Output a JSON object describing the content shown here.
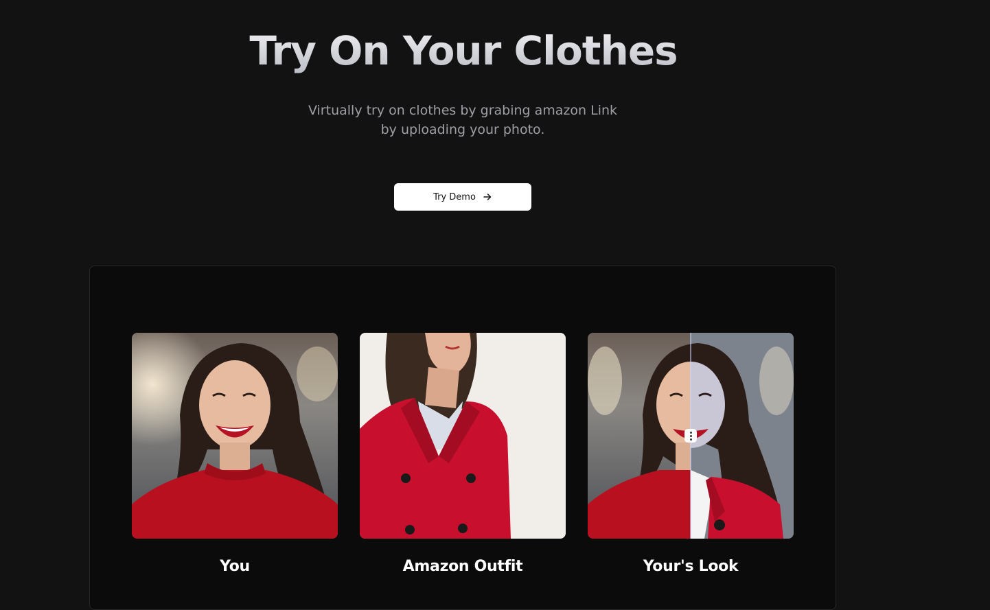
{
  "hero": {
    "title": "Try On Your Clothes",
    "subtitle": "Virtually try on clothes by grabing amazon Link by uploading your photo.",
    "cta_label": "Try Demo"
  },
  "cards": [
    {
      "label": "You"
    },
    {
      "label": "Amazon Outfit"
    },
    {
      "label": "Your's Look"
    }
  ],
  "colors": {
    "background": "#121212",
    "panel": "#0b0b0b",
    "outfit_red": "#c8102e"
  }
}
